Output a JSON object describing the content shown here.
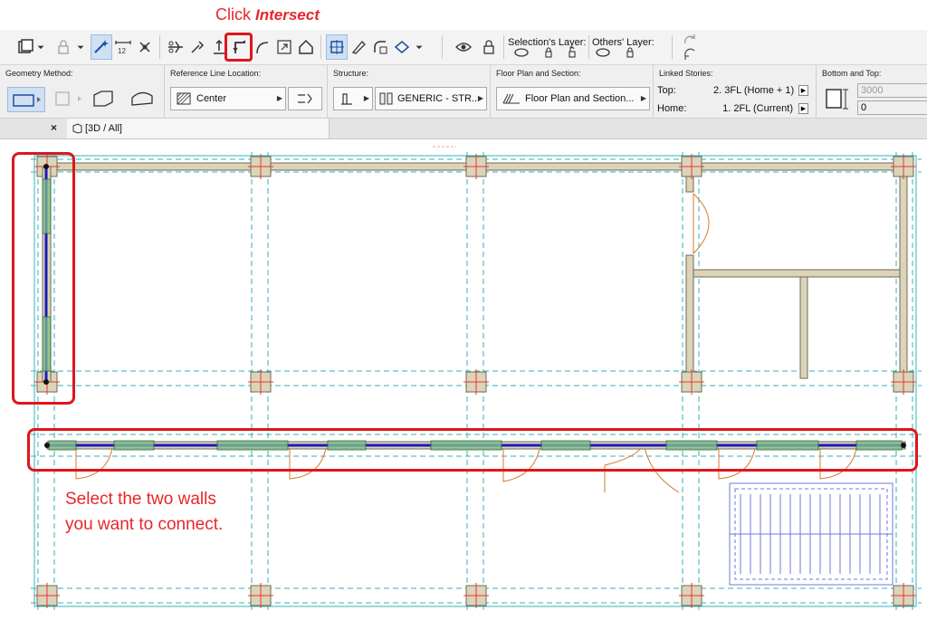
{
  "callouts": {
    "top_prefix": "Click",
    "top_emphasis": "Intersect",
    "bottom_line1": "Select the two walls",
    "bottom_line2": "you want to connect."
  },
  "toolbar": {
    "selection_layer_label": "Selection's Layer:",
    "others_layer_label": "Others' Layer:",
    "icons": [
      "pet-palette-icon",
      "dropdown-icon",
      "lock-icon",
      "dropdown-icon",
      "magic-wand-icon",
      "dimension-icon",
      "cross-icon",
      "split-icon",
      "adjust-icon",
      "offset-icon",
      "intersect-icon",
      "curve-icon",
      "resize-icon",
      "roof-icon",
      "grid-snap-icon",
      "edit-icon",
      "fillet-icon",
      "elevate-icon",
      "dropdown-icon",
      "eye-icon",
      "lock-layer-icon",
      "undo-icon",
      "redo-icon"
    ]
  },
  "infobox": {
    "geometry": {
      "title": "Geometry Method:"
    },
    "reference_line": {
      "title": "Reference Line Location:",
      "value": "Center"
    },
    "structure": {
      "title": "Structure:",
      "value": "GENERIC - STR..."
    },
    "floor_plan": {
      "title": "Floor Plan and Section:",
      "value": "Floor Plan and Section..."
    },
    "linked_stories": {
      "title": "Linked Stories:",
      "top_label": "Top:",
      "top_value": "2. 3FL (Home + 1)",
      "home_label": "Home:",
      "home_value": "1. 2FL (Current)"
    },
    "bottom_top": {
      "title": "Bottom and Top:",
      "top_height": "3000",
      "bottom_offset": "0"
    }
  },
  "tabs": {
    "close_glyph": "×",
    "view_3d": "[3D / All]"
  },
  "colors": {
    "accent_red": "#e0151c",
    "wall_fill": "#dcd4b9",
    "selected_wall": "#1a1abf",
    "grid_line": "#36b2b8",
    "toolbar_bg": "#f3f3f3"
  }
}
